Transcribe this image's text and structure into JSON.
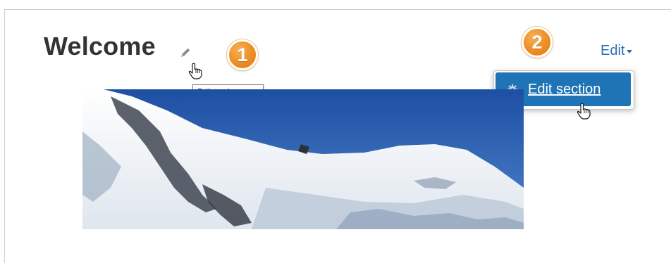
{
  "section": {
    "title": "Welcome"
  },
  "tooltip": {
    "text": "Edit topic name"
  },
  "callouts": {
    "step1": "1",
    "step2": "2"
  },
  "edit_menu": {
    "trigger_label": "Edit",
    "items": [
      {
        "label": "Edit section",
        "icon": "gear-icon"
      }
    ]
  },
  "colors": {
    "link": "#2a6db5",
    "menu_highlight": "#1f74b6",
    "badge_orange": "#f0922a"
  }
}
